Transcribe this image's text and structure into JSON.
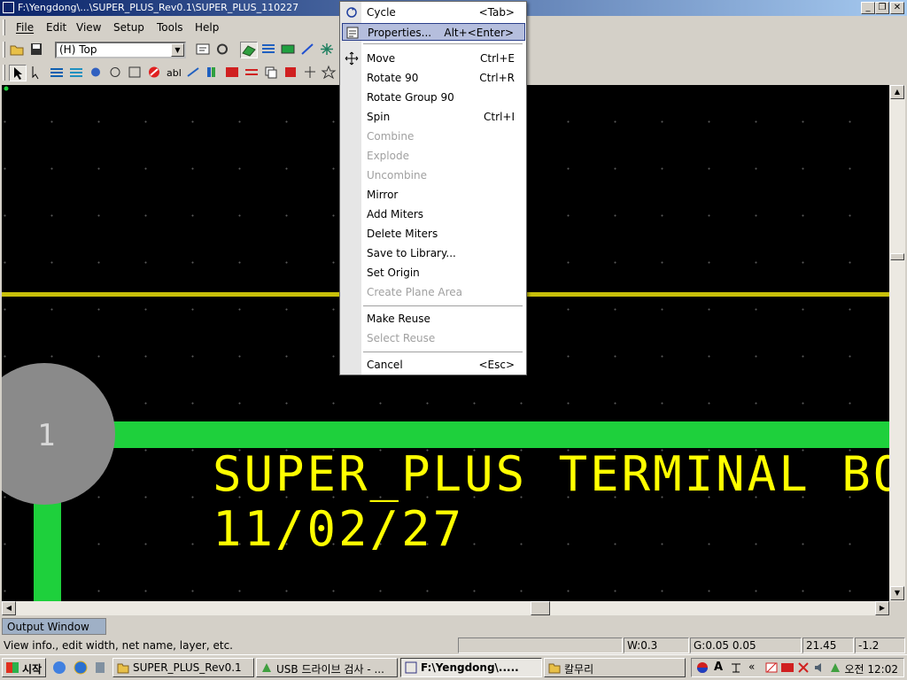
{
  "window": {
    "title": "F:\\Yengdong\\...\\SUPER_PLUS_Rev0.1\\SUPER_PLUS_110227"
  },
  "menubar": {
    "items": [
      "File",
      "Edit",
      "View",
      "Setup",
      "Tools",
      "Help"
    ]
  },
  "toolbar": {
    "layer_selected": "(H) Top"
  },
  "context_menu": {
    "items": [
      {
        "label": "Cycle",
        "shortcut": "<Tab>",
        "enabled": true
      },
      {
        "label": "Properties...",
        "shortcut": "Alt+<Enter>",
        "enabled": true,
        "highlighted": true
      },
      {
        "label": "Move",
        "shortcut": "Ctrl+E",
        "enabled": true
      },
      {
        "label": "Rotate 90",
        "shortcut": "Ctrl+R",
        "enabled": true
      },
      {
        "label": "Rotate Group 90",
        "shortcut": "",
        "enabled": true
      },
      {
        "label": "Spin",
        "shortcut": "Ctrl+I",
        "enabled": true
      },
      {
        "label": "Combine",
        "shortcut": "",
        "enabled": false
      },
      {
        "label": "Explode",
        "shortcut": "",
        "enabled": false
      },
      {
        "label": "Uncombine",
        "shortcut": "",
        "enabled": false
      },
      {
        "label": "Mirror",
        "shortcut": "",
        "enabled": true
      },
      {
        "label": "Add Miters",
        "shortcut": "",
        "enabled": true
      },
      {
        "label": "Delete Miters",
        "shortcut": "",
        "enabled": true
      },
      {
        "label": "Save to Library...",
        "shortcut": "",
        "enabled": true
      },
      {
        "label": "Set Origin",
        "shortcut": "",
        "enabled": true
      },
      {
        "label": "Create Plane Area",
        "shortcut": "",
        "enabled": false
      },
      {
        "label": "Make Reuse",
        "shortcut": "",
        "enabled": true
      },
      {
        "label": "Select Reuse",
        "shortcut": "",
        "enabled": false
      },
      {
        "label": "Cancel",
        "shortcut": "<Esc>",
        "enabled": true
      }
    ]
  },
  "board": {
    "text_line1": "SUPER_PLUS TERMINAL BOX",
    "text_line2": "11/02/27",
    "pad_label": "1",
    "colors": {
      "trace": "#1ed03c",
      "text": "#ffff00",
      "line": "#c8c00a",
      "pad": "#8a8a8a"
    }
  },
  "output_window": {
    "label": "Output Window"
  },
  "status": {
    "hint": "View info., edit width, net name, layer, etc.",
    "width": "W:0.3",
    "grid": "G:0.05 0.05",
    "x": "21.45",
    "y": "-1.2"
  },
  "taskbar": {
    "start_label": "시작",
    "tasks": [
      {
        "label": "SUPER_PLUS_Rev0.1",
        "active": false
      },
      {
        "label": "USB 드라이브 검사 - ...",
        "active": false
      },
      {
        "label": "F:\\Yengdong\\.....",
        "active": true
      },
      {
        "label": "칼무리",
        "active": false
      }
    ],
    "tray_chevron": "«",
    "tray_ime": "A",
    "clock": "오전 12:02"
  }
}
